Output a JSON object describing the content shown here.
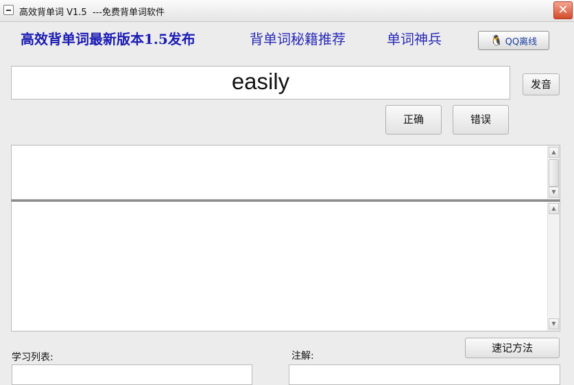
{
  "window": {
    "title": "高效背单词 V1.5  ---免费背单词软件",
    "close_symbol": "✕"
  },
  "links": {
    "main": "高效背单词最新版本1.5发布",
    "tips": "背单词秘籍推荐",
    "tool": "单词神兵"
  },
  "qq": {
    "icon": "penguin-icon",
    "label": "QQ离线"
  },
  "word": {
    "current": "easily"
  },
  "buttons": {
    "speak": "发音",
    "correct": "正确",
    "wrong": "错误",
    "memory_method": "速记方法"
  },
  "labels": {
    "study_list": "学习列表:",
    "notes": "注解:"
  },
  "scroll_arrows": {
    "up": "▲",
    "down": "▼"
  }
}
